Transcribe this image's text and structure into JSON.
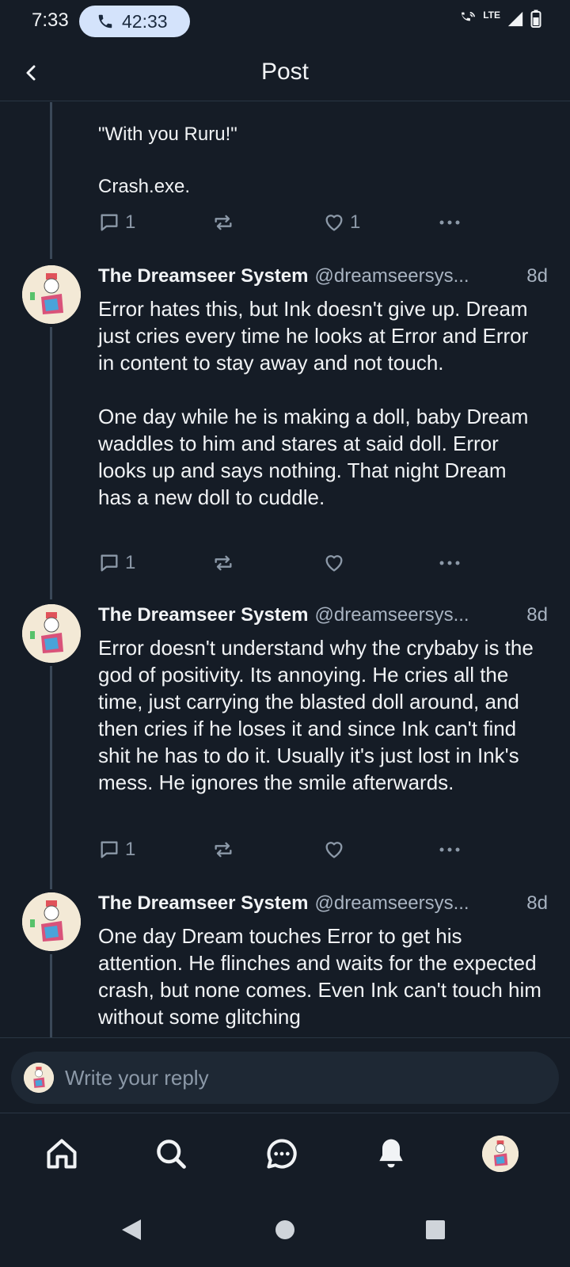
{
  "status_bar": {
    "time": "7:33",
    "call_duration": "42:33",
    "network": "LTE"
  },
  "header": {
    "title": "Post"
  },
  "thread": {
    "tail": {
      "line1": "\"With you Ruru!\"",
      "line2": "Crash.exe.",
      "reply_count": "1",
      "like_count": "1"
    },
    "posts": [
      {
        "name": "The Dreamseer System",
        "handle": "@dreamseersys...",
        "age": "8d",
        "body": "Error hates this, but Ink doesn't give up. Dream just cries every time he looks at Error and Error in content to stay away and not touch.\n\nOne day while he is making a doll, baby Dream waddles to him and stares at said doll. Error looks up and says nothing. That night Dream has a new doll to cuddle.",
        "reply_count": "1"
      },
      {
        "name": "The Dreamseer System",
        "handle": "@dreamseersys...",
        "age": "8d",
        "body": "Error doesn't understand why the crybaby is the god of positivity. Its annoying. He cries all the time, just carrying the blasted doll around, and then cries if he loses it and since Ink can't find shit he has to do it. Usually it's just lost in Ink's mess. He ignores the smile afterwards.",
        "reply_count": "1"
      },
      {
        "name": "The Dreamseer System",
        "handle": "@dreamseersys...",
        "age": "8d",
        "body": "One day Dream touches Error to get his attention. He flinches and waits for the expected crash, but none comes. Even Ink can't touch him without some glitching"
      }
    ]
  },
  "reply_bar": {
    "placeholder": "Write your reply"
  },
  "bottom_nav": {
    "items": [
      "home-icon",
      "search-icon",
      "chat-icon",
      "notifications-icon",
      "profile-avatar"
    ]
  },
  "colors": {
    "background": "#151c26",
    "text": "#f1f3f5",
    "muted": "#a8b3c1",
    "icon": "#8c99a8",
    "call_pill": "#d4e3fb"
  }
}
